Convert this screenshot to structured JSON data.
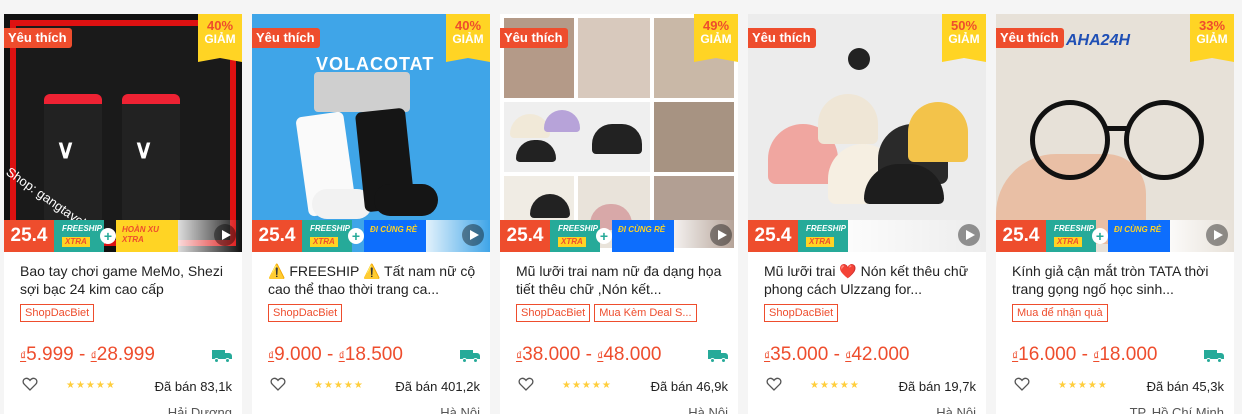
{
  "products": [
    {
      "fav": "Yêu thích",
      "discount": "40%",
      "discount_label": "GIẢM",
      "banner_date": "25.4",
      "banner_ship": "FREESHIP",
      "banner_xtra": "XTRA",
      "banner_plus": "+",
      "banner_right": "HOÀN XU XTRA",
      "name": "Bao tay chơi game MeMo, Shezi sợi bạc 24 kim cao cấp",
      "tags": [
        "ShopDacBiet"
      ],
      "currency": "₫",
      "price_min": "5.999",
      "price_sep": " - ",
      "price_max": "28.999",
      "stars": "★★★★★",
      "sold": "Đã bán 83,1k",
      "location": "Hải Dương",
      "image_text": "Shop: gangtaychoing"
    },
    {
      "fav": "Yêu thích",
      "discount": "40%",
      "discount_label": "GIẢM",
      "banner_date": "25.4",
      "banner_ship": "FREESHIP",
      "banner_xtra": "XTRA",
      "banner_plus": "+",
      "banner_right": "ĐI CÙNG RẺ",
      "name": "⚠️ FREESHIP ⚠️ Tất nam nữ cộ cao thể thao thời trang ca...",
      "tags": [
        "ShopDacBiet"
      ],
      "currency": "₫",
      "price_min": "9.000",
      "price_sep": " - ",
      "price_max": "18.500",
      "stars": "★★★★★",
      "sold": "Đã bán 401,2k",
      "location": "Hà Nội",
      "image_text": "VOLACOTAT"
    },
    {
      "fav": "Yêu thích",
      "discount": "49%",
      "discount_label": "GIẢM",
      "banner_date": "25.4",
      "banner_ship": "FREESHIP",
      "banner_xtra": "XTRA",
      "banner_plus": "+",
      "banner_right": "ĐI CÙNG RẺ",
      "name": "Mũ lưỡi trai nam nữ đa dạng họa tiết thêu chữ ,Nón kết...",
      "tags": [
        "ShopDacBiet",
        "Mua Kèm Deal S..."
      ],
      "currency": "₫",
      "price_min": "38.000",
      "price_sep": " - ",
      "price_max": "48.000",
      "stars": "★★★★★",
      "sold": "Đã bán 46,9k",
      "location": "Hà Nội",
      "image_text": ""
    },
    {
      "fav": "Yêu thích",
      "discount": "50%",
      "discount_label": "GIẢM",
      "banner_date": "25.4",
      "banner_ship": "FREESHIP",
      "banner_xtra": "XTRA",
      "banner_plus": "",
      "banner_right": "",
      "name": "Mũ lưỡi trai ❤️ Nón kết thêu chữ phong cách Ulzzang for...",
      "tags": [
        "ShopDacBiet"
      ],
      "currency": "₫",
      "price_min": "35.000",
      "price_sep": " - ",
      "price_max": "42.000",
      "stars": "★★★★★",
      "sold": "Đã bán 19,7k",
      "location": "Hà Nội",
      "image_text": ""
    },
    {
      "fav": "Yêu thích",
      "discount": "33%",
      "discount_label": "GIẢM",
      "banner_date": "25.4",
      "banner_ship": "FREESHIP",
      "banner_xtra": "XTRA",
      "banner_plus": "+",
      "banner_right": "ĐI CÙNG RẺ",
      "name": "Kính giả cận mắt tròn TATA thời trang gọng ngố học sinh...",
      "tags": [
        "Mua để nhận quà"
      ],
      "currency": "₫",
      "price_min": "16.000",
      "price_sep": " - ",
      "price_max": "18.000",
      "stars": "★★★★★",
      "sold": "Đã bán 45,3k",
      "location": "TP. Hồ Chí Minh",
      "image_text": "AHA24H"
    }
  ],
  "colors": {
    "brand": "#ee4d2d",
    "teal": "#26aa99",
    "yellow": "#ffd424",
    "stars": "#ffce3d"
  },
  "icons": {
    "heart": "heart-outline-icon",
    "play": "play-video-icon",
    "truck": "free-ship-truck-icon"
  }
}
